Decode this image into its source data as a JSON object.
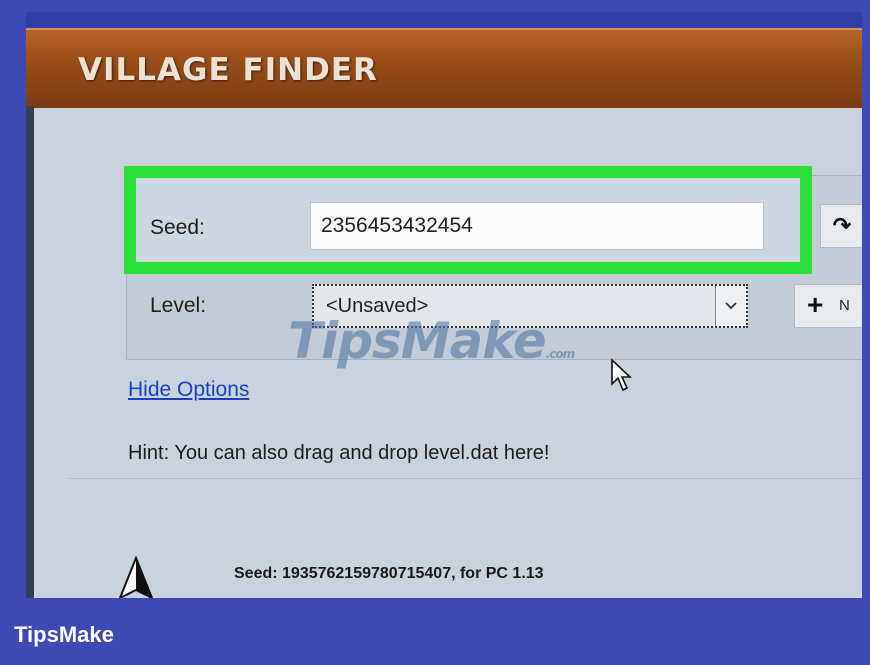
{
  "window": {
    "title": "VILLAGE FINDER"
  },
  "options": {
    "seed_label": "Seed:",
    "seed_value": "2356453432454",
    "level_label": "Level:",
    "level_value": "<Unsaved>",
    "new_button_label": "N",
    "hide_options_link": "Hide Options",
    "hint": "Hint: You can also drag and drop level.dat here!"
  },
  "result": {
    "seed_info": "Seed: 1935762159780715407, for PC 1.13"
  },
  "watermark": {
    "text": "TipsMake",
    "suffix": ".com"
  },
  "footer": {
    "brand": "TipsMake"
  },
  "icons": {
    "refresh": "refresh-arrow-icon",
    "dropdown": "chevron-down-icon",
    "plus": "plus-icon",
    "map": "map-marker-icon",
    "cursor": "mouse-pointer-icon"
  },
  "colors": {
    "titlebar": "#9c4f1a",
    "highlight": "#29e038",
    "link": "#1f3fc8",
    "background": "#3f49b4"
  }
}
